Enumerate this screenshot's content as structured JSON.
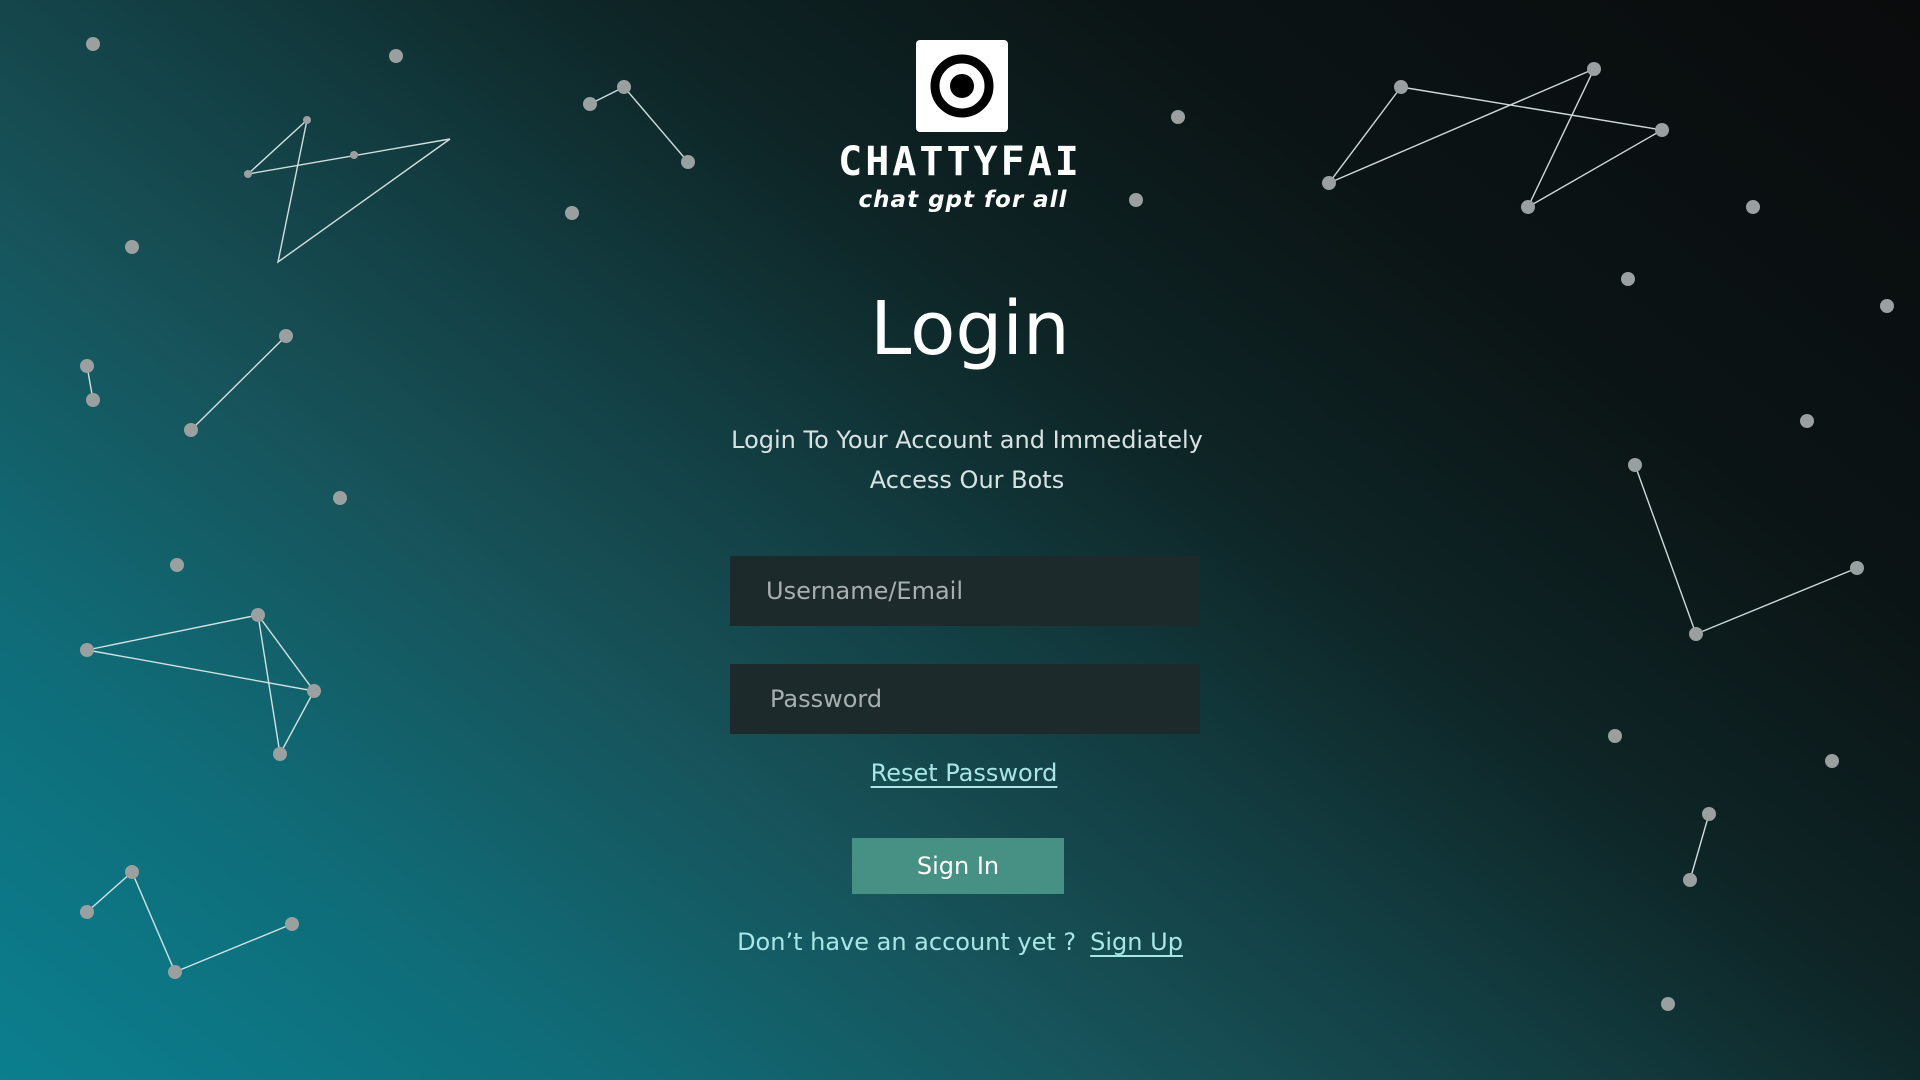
{
  "brand": {
    "logo_icon": "target-ring-icon",
    "name": "CHATTYFAI",
    "tagline": "chat gpt for all"
  },
  "login": {
    "title": "Login",
    "subtitle": "Login To Your Account and  Immediately Access Our Bots",
    "username_placeholder": "Username/Email",
    "password_placeholder": "Password",
    "reset_password_label": "Reset Password",
    "sign_in_label": "Sign In",
    "no_account_text": "Don’t have an account yet ?",
    "sign_up_label": "Sign Up"
  },
  "colors": {
    "gradient_light": "#0b7f8f",
    "gradient_dark": "#0a0b0c",
    "field_background": "#1d2a2c",
    "button_background": "#469084",
    "link_color": "#a9e6e6",
    "star_dot": "#9a9fa0",
    "constellation_line": "#e6f0f0"
  }
}
